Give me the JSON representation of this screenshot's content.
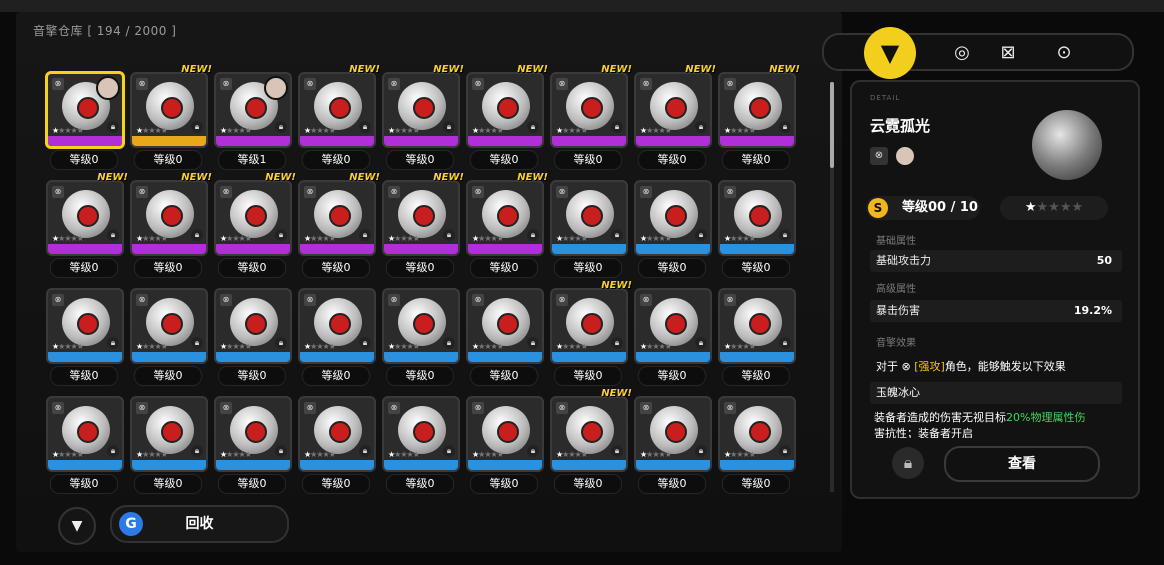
{
  "header": {
    "title": "音擎仓库 [ 194 / 2000 ]"
  },
  "tabs": [
    {
      "icon": "equipment-triangle-icon",
      "active": true
    },
    {
      "icon": "disc-ring-icon",
      "active": false
    },
    {
      "icon": "box-x-icon",
      "active": false
    },
    {
      "icon": "safe-icon",
      "active": false
    }
  ],
  "grid": {
    "rows": [
      [
        {
          "level": "等级0",
          "bar": "purple",
          "selected": true,
          "equipped": true,
          "new": false
        },
        {
          "level": "等级0",
          "bar": "gold",
          "selected": false,
          "equipped": false,
          "new": true
        },
        {
          "level": "等级1",
          "bar": "purple",
          "selected": false,
          "equipped": true,
          "new": false
        },
        {
          "level": "等级0",
          "bar": "purple",
          "selected": false,
          "equipped": false,
          "new": true
        },
        {
          "level": "等级0",
          "bar": "purple",
          "selected": false,
          "equipped": false,
          "new": true
        },
        {
          "level": "等级0",
          "bar": "purple",
          "selected": false,
          "equipped": false,
          "new": true
        },
        {
          "level": "等级0",
          "bar": "purple",
          "selected": false,
          "equipped": false,
          "new": true
        },
        {
          "level": "等级0",
          "bar": "purple",
          "selected": false,
          "equipped": false,
          "new": true
        },
        {
          "level": "等级0",
          "bar": "purple",
          "selected": false,
          "equipped": false,
          "new": true
        }
      ],
      [
        {
          "level": "等级0",
          "bar": "purple",
          "new": true
        },
        {
          "level": "等级0",
          "bar": "purple",
          "new": true
        },
        {
          "level": "等级0",
          "bar": "purple",
          "new": true
        },
        {
          "level": "等级0",
          "bar": "purple",
          "new": true
        },
        {
          "level": "等级0",
          "bar": "purple",
          "new": true
        },
        {
          "level": "等级0",
          "bar": "purple",
          "new": true
        },
        {
          "level": "等级0",
          "bar": "blue",
          "new": false
        },
        {
          "level": "等级0",
          "bar": "blue",
          "new": false
        },
        {
          "level": "等级0",
          "bar": "blue",
          "new": false
        }
      ],
      [
        {
          "level": "等级0",
          "bar": "blue",
          "new": false
        },
        {
          "level": "等级0",
          "bar": "blue",
          "new": false
        },
        {
          "level": "等级0",
          "bar": "blue",
          "new": false
        },
        {
          "level": "等级0",
          "bar": "blue",
          "new": false
        },
        {
          "level": "等级0",
          "bar": "blue",
          "new": false
        },
        {
          "level": "等级0",
          "bar": "blue",
          "new": false
        },
        {
          "level": "等级0",
          "bar": "blue",
          "new": true
        },
        {
          "level": "等级0",
          "bar": "blue",
          "new": false
        },
        {
          "level": "等级0",
          "bar": "blue",
          "new": false
        }
      ],
      [
        {
          "level": "等级0",
          "bar": "blue",
          "new": false
        },
        {
          "level": "等级0",
          "bar": "blue",
          "new": false
        },
        {
          "level": "等级0",
          "bar": "blue",
          "new": false
        },
        {
          "level": "等级0",
          "bar": "blue",
          "new": false
        },
        {
          "level": "等级0",
          "bar": "blue",
          "new": false
        },
        {
          "level": "等级0",
          "bar": "blue",
          "new": false
        },
        {
          "level": "等级0",
          "bar": "blue",
          "new": true
        },
        {
          "level": "等级0",
          "bar": "blue",
          "new": false
        },
        {
          "level": "等级0",
          "bar": "blue",
          "new": false
        }
      ]
    ],
    "new_label": "NEW!"
  },
  "footer": {
    "recycle_label": "回收"
  },
  "detail": {
    "tag": "DETAIL",
    "name": "云霓孤光",
    "level": "等级00 / 10",
    "stars": "★★★★★",
    "stars_filled": 1,
    "base_section": "基础属性",
    "base_stat_name": "基础攻击力",
    "base_stat_value": "50",
    "adv_section": "高级属性",
    "adv_stat_name": "暴击伤害",
    "adv_stat_value": "19.2%",
    "effect_section": "音擎效果",
    "effect_pre": "对于",
    "effect_tag": "[强攻]",
    "effect_post": "角色，能够触发以下效果",
    "set_name": "玉魄冰心",
    "desc_pre": "装备者造成的伤害无视目标",
    "desc_green": "20%物理属性伤",
    "desc_rest": "害抗性；装备者开启",
    "view_label": "查看"
  },
  "colors": {
    "accent": "#f2cf1c",
    "purple": "#b12fd8",
    "blue": "#2a90e0"
  }
}
